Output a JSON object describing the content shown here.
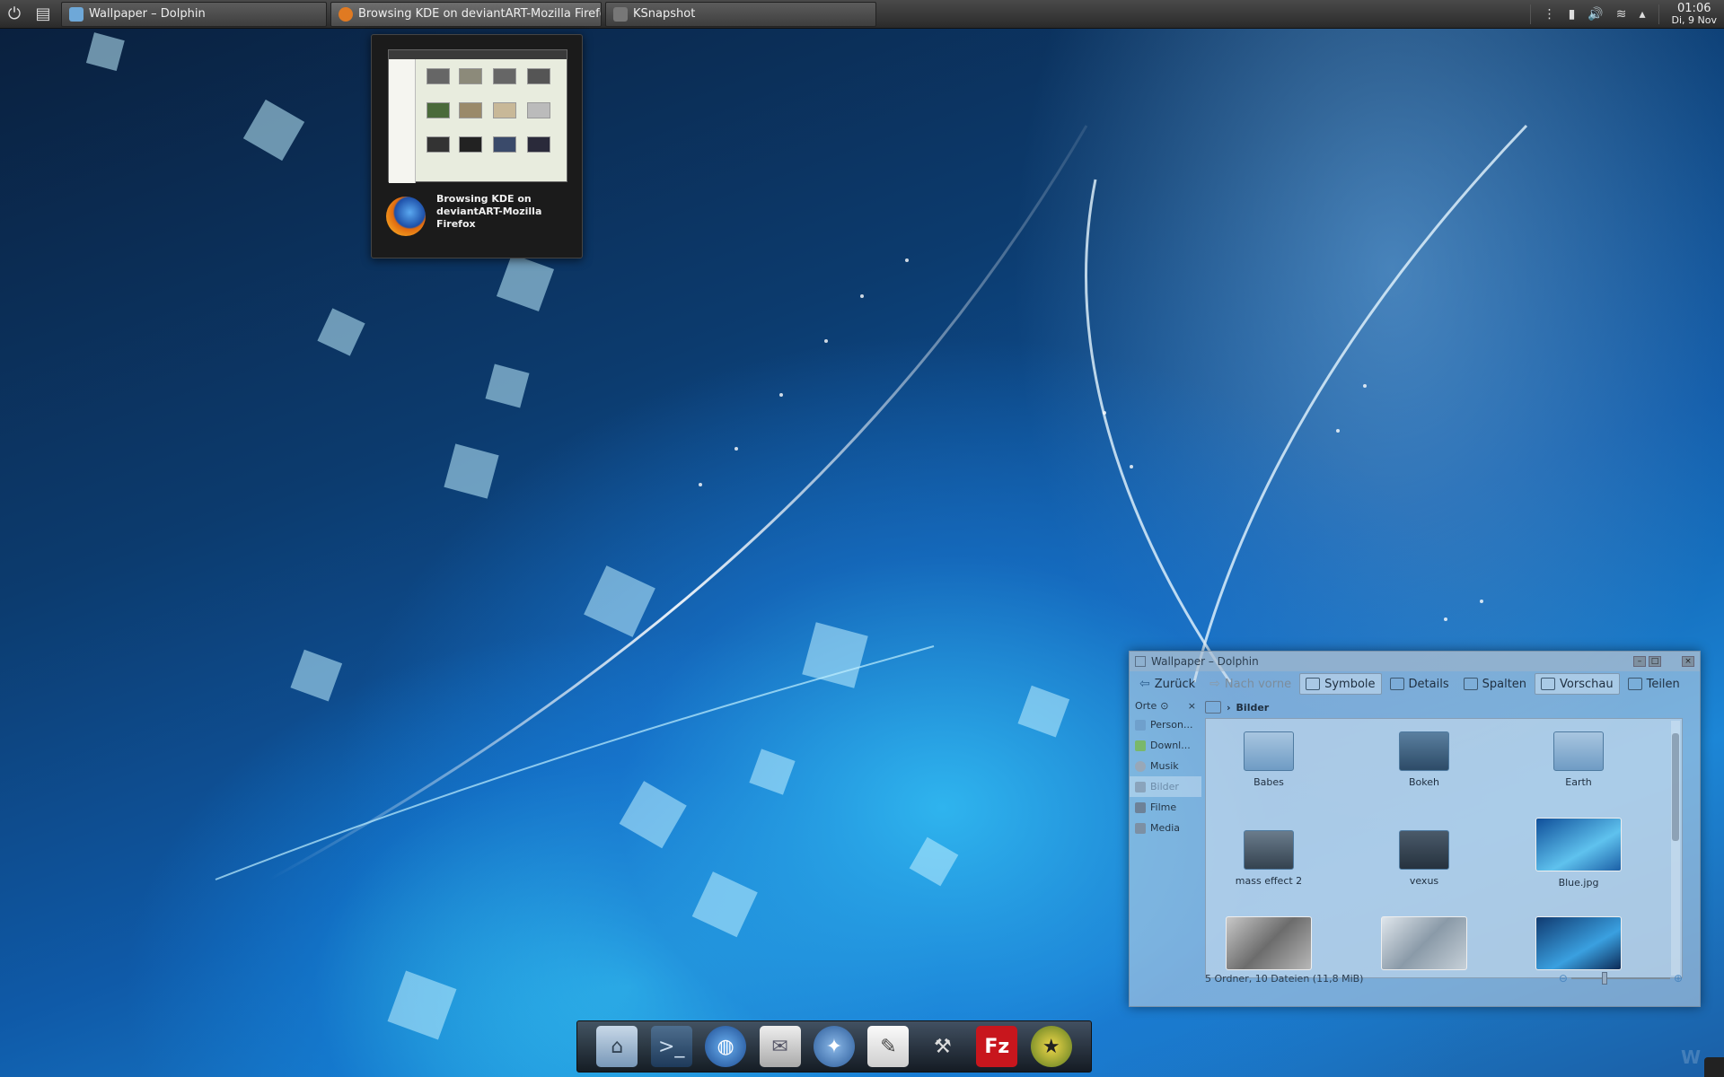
{
  "taskbar": {
    "tasks": [
      {
        "label": "Wallpaper – Dolphin",
        "icon": "dolphin-icon",
        "color": "#6ea8d8"
      },
      {
        "label": "Browsing KDE on deviantART-Mozilla Firefox",
        "icon": "firefox-icon",
        "color": "#e07a22"
      },
      {
        "label": "KSnapshot",
        "icon": "camera-icon",
        "color": "#777777"
      }
    ],
    "clock_time": "01:06",
    "clock_date": "Di, 9 Nov"
  },
  "tooltip": {
    "title": "Browsing KDE on deviantART-Mozilla Firefox"
  },
  "dolphin": {
    "title": "Wallpaper – Dolphin",
    "toolbar": {
      "back": "Zurück",
      "forward": "Nach vorne",
      "icons": "Symbole",
      "details": "Details",
      "columns": "Spalten",
      "preview": "Vorschau",
      "split": "Teilen"
    },
    "places": {
      "header": "Orte",
      "items": [
        {
          "label": "Person...",
          "icon": "home-folder-icon"
        },
        {
          "label": "Downl...",
          "icon": "download-icon"
        },
        {
          "label": "Musik",
          "icon": "music-icon"
        },
        {
          "label": "Bilder",
          "icon": "pictures-icon"
        },
        {
          "label": "Filme",
          "icon": "video-icon"
        },
        {
          "label": "Media",
          "icon": "media-icon"
        }
      ]
    },
    "breadcrumb": "Bilder",
    "files": [
      {
        "name": "Babes",
        "type": "folder"
      },
      {
        "name": "Bokeh",
        "type": "folder"
      },
      {
        "name": "Earth",
        "type": "folder"
      },
      {
        "name": "mass effect 2",
        "type": "folder"
      },
      {
        "name": "vexus",
        "type": "folder"
      },
      {
        "name": "Blue.jpg",
        "type": "image"
      },
      {
        "name": "",
        "type": "image"
      },
      {
        "name": "",
        "type": "image"
      },
      {
        "name": "",
        "type": "image"
      }
    ],
    "status": "5 Ordner, 10 Dateien (11,8 MiB)"
  },
  "dock": {
    "apps": [
      "home-folder-icon",
      "terminal-icon",
      "globe-icon",
      "mail-icon",
      "thunderbird-icon",
      "text-editor-icon",
      "tools-icon",
      "filezilla-icon",
      "wine-icon"
    ]
  },
  "watermark": "W"
}
